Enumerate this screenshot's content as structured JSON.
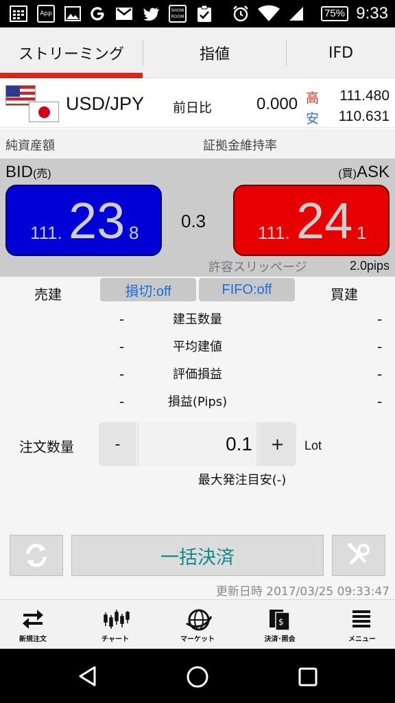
{
  "status_bar": {
    "time": "9:33",
    "battery": "75%",
    "app_icon_text": "App",
    "showroom_text": "SHOW ROOM"
  },
  "tabs": [
    {
      "label": "ストリーミング",
      "active": true
    },
    {
      "label": "指値",
      "active": false
    },
    {
      "label": "IFD",
      "active": false
    }
  ],
  "pair": {
    "name": "USD/JPY",
    "prev_label": "前日比",
    "prev_value": "0.000",
    "high_label": "高",
    "high_value": "111.480",
    "low_label": "安",
    "low_value": "110.631"
  },
  "assets": {
    "net_assets_label": "純資産額",
    "margin_ratio_label": "証拠金維持率"
  },
  "quote": {
    "bid_label": "BID",
    "bid_sub": "(売)",
    "ask_label": "ASK",
    "ask_sub": "(買)",
    "bid": {
      "prefix": "111.",
      "big": "23",
      "tail": "8"
    },
    "ask": {
      "prefix": "111.",
      "big": "24",
      "tail": "1"
    },
    "spread": "0.3",
    "slippage_label": "許容スリッページ",
    "slippage_value": "2.0pips"
  },
  "positions": {
    "sell_label": "売建",
    "buy_label": "買建",
    "stoploss_toggle": "損切:off",
    "fifo_toggle": "FIFO:off",
    "rows": [
      {
        "name": "建玉数量",
        "sell": "-",
        "buy": "-"
      },
      {
        "name": "平均建値",
        "sell": "-",
        "buy": "-"
      },
      {
        "name": "評価損益",
        "sell": "-",
        "buy": "-"
      },
      {
        "name": "損益(Pips)",
        "sell": "-",
        "buy": "-"
      }
    ]
  },
  "order": {
    "qty_label": "注文数量",
    "minus": "-",
    "plus": "+",
    "qty_value": "0.1",
    "unit": "Lot",
    "max_label": "最大発注目安(-)"
  },
  "actions": {
    "settle_all": "一括決済"
  },
  "updated": "更新日時 2017/03/25 09:33:47",
  "bottom_nav": [
    {
      "label": "新規注文",
      "icon": "swap-arrows-icon"
    },
    {
      "label": "チャート",
      "icon": "candlestick-icon"
    },
    {
      "label": "マーケット",
      "icon": "globe-icon"
    },
    {
      "label": "決済･照会",
      "icon": "document-yen-icon"
    },
    {
      "label": "メニュー",
      "icon": "menu-icon"
    }
  ]
}
